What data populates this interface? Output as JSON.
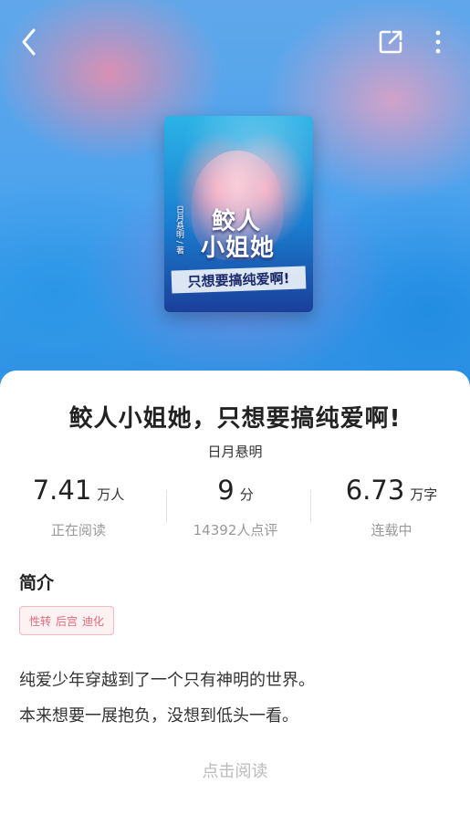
{
  "topbar": {
    "back_icon": "back-arrow-icon",
    "share_icon": "share-icon",
    "more_icon": "more-vertical-icon"
  },
  "cover": {
    "title_line1": "鲛人",
    "title_line2": "小姐她",
    "subtitle": "只想要搞纯爱啊!",
    "author": "日月悬明 / 著"
  },
  "book": {
    "title": "鲛人小姐她，只想要搞纯爱啊!",
    "author": "日月悬明"
  },
  "stats": [
    {
      "value": "7.41",
      "unit": "万人",
      "label": "正在阅读"
    },
    {
      "value": "9",
      "unit": "分",
      "label": "14392人点评"
    },
    {
      "value": "6.73",
      "unit": "万字",
      "label": "连载中"
    }
  ],
  "intro": {
    "heading": "简介",
    "tags": [
      "性转",
      "后宫",
      "迪化"
    ],
    "lines": [
      "纯爱少年穿越到了一个只有神明的世界。",
      "本来想要一展抱负，没想到低头一看。"
    ]
  },
  "cta": {
    "label": "点击阅读"
  },
  "colors": {
    "tag_text": "#e06b7b",
    "tag_border": "#f1b8c0",
    "muted": "#999999"
  }
}
